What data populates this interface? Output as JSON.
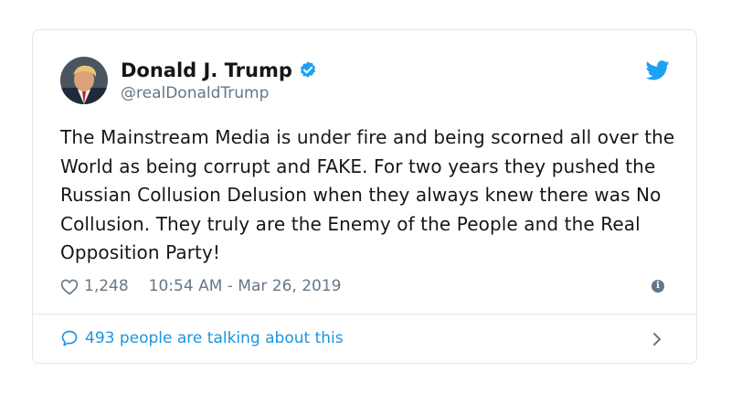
{
  "author": {
    "name": "Donald J. Trump",
    "handle": "@realDonaldTrump",
    "verified": true
  },
  "tweet": {
    "text": "The Mainstream Media is under fire and being scorned all over the World as being corrupt and FAKE. For two years they pushed the Russian Collusion Delusion when they always knew there was No Collusion. They truly are the Enemy of the People and the Real Opposition Party!",
    "likes": "1,248",
    "timestamp": "10:54 AM - Mar 26, 2019"
  },
  "footer": {
    "talking_label": "493 people are talking about this"
  },
  "colors": {
    "accent": "#1da1f2",
    "link": "#1b95e0",
    "muted": "#657786",
    "border": "#e1e8ed"
  },
  "icons": [
    "twitter-bird-icon",
    "verified-badge-icon",
    "heart-icon",
    "info-icon",
    "speech-bubble-icon",
    "chevron-right-icon"
  ]
}
